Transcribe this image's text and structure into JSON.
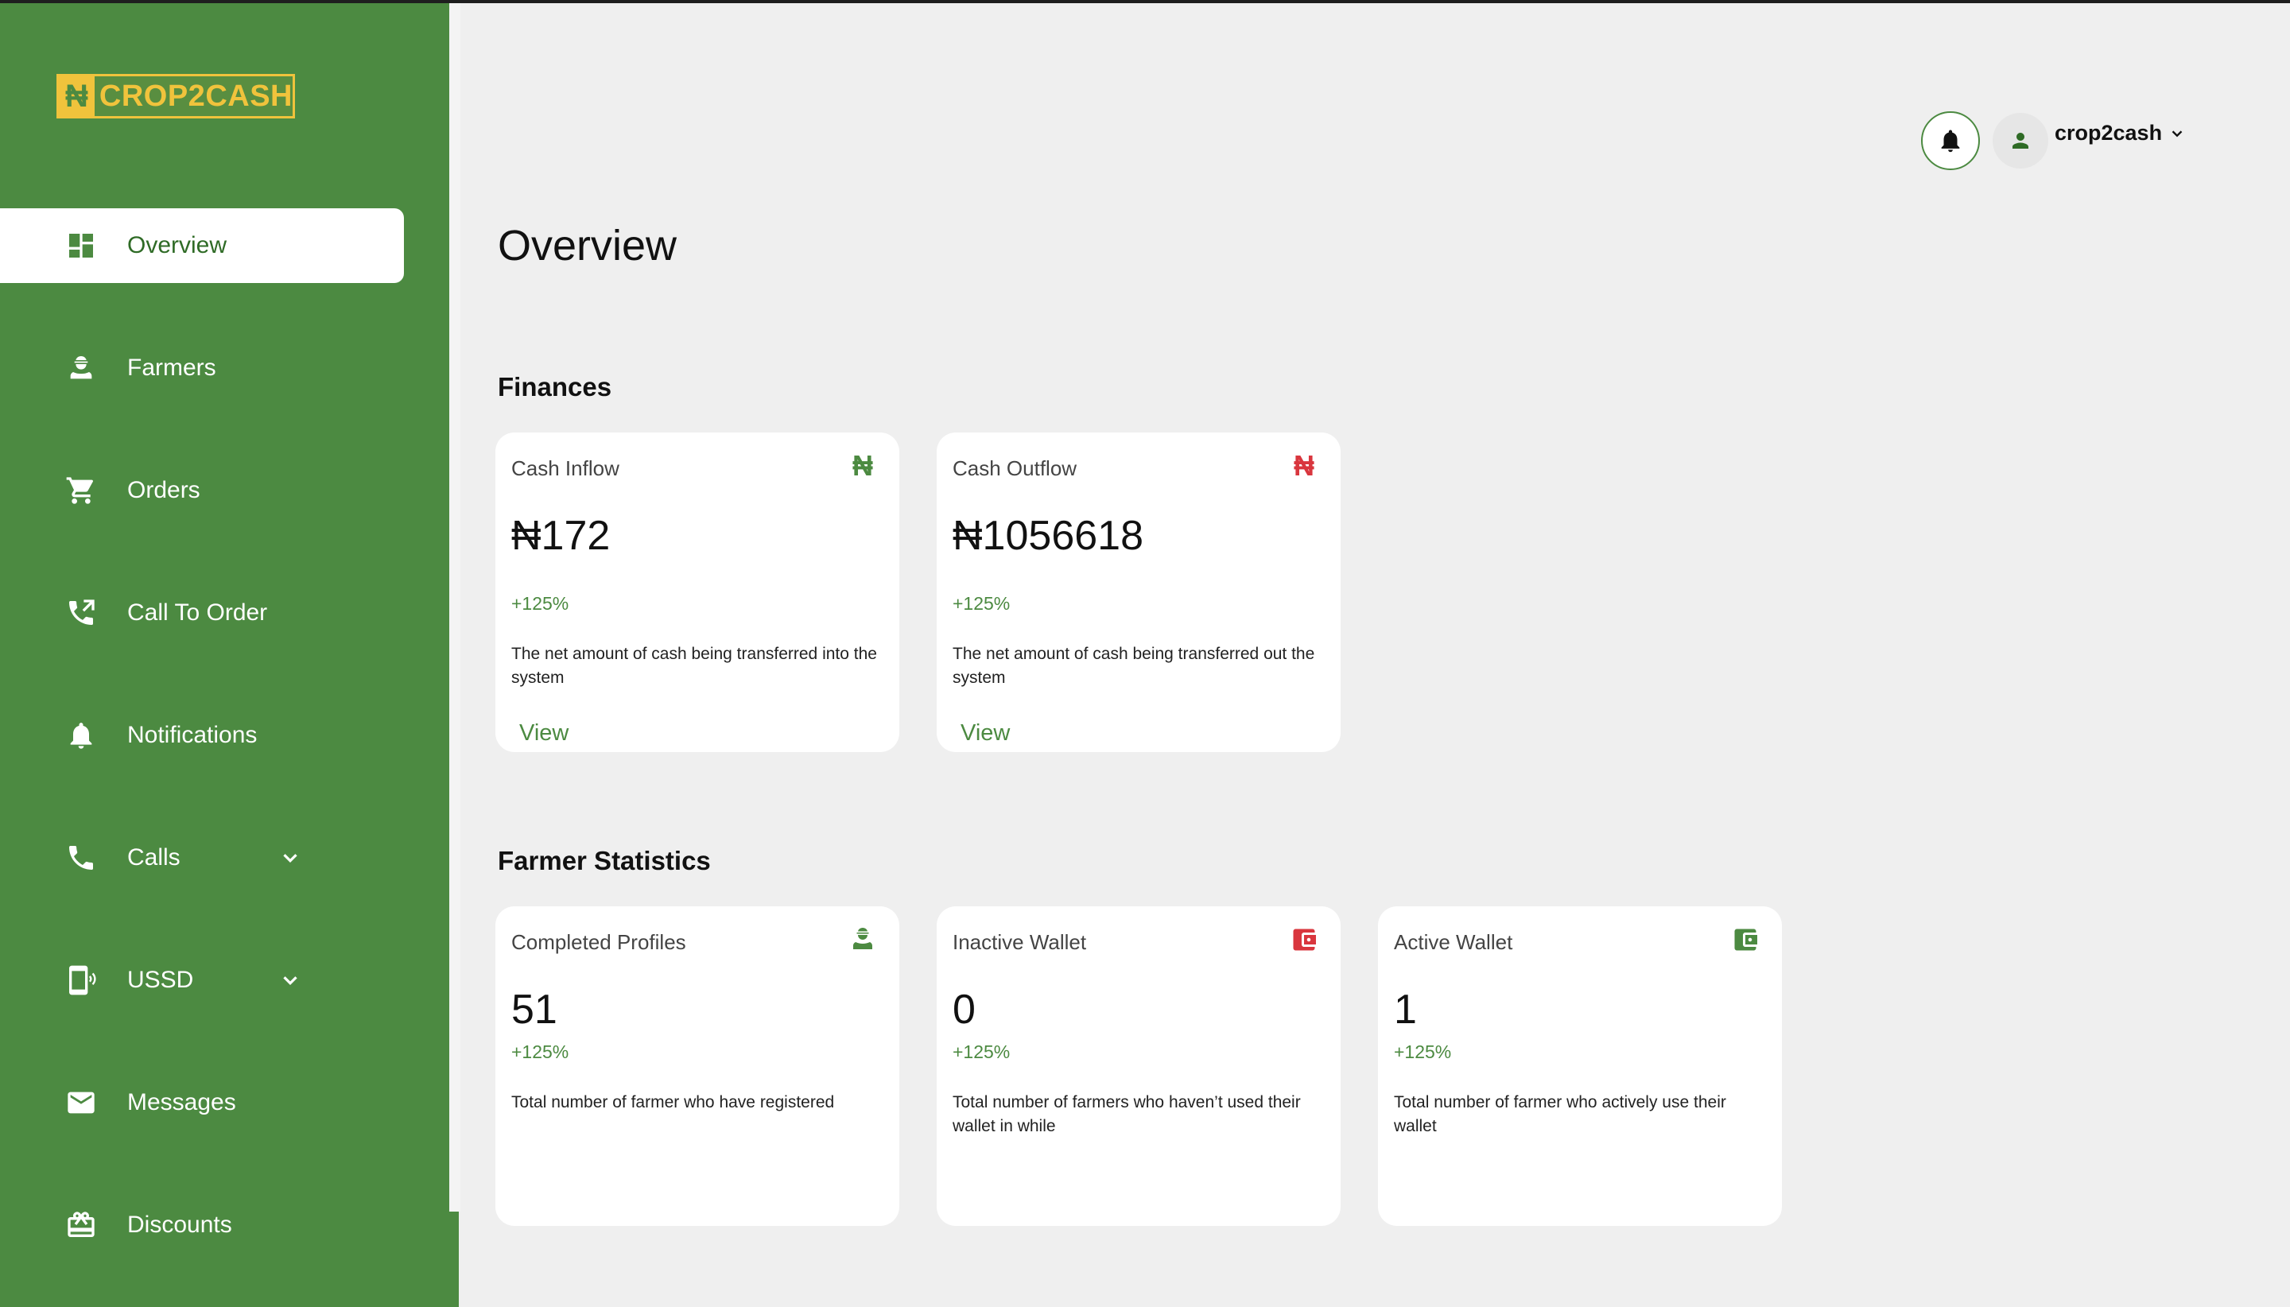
{
  "brand": {
    "logo_mark": "₦",
    "logo_text": "CROP2CASH",
    "color": "#4c8a41",
    "accent": "#f0c33c"
  },
  "sidebar": {
    "items": [
      {
        "label": "Overview",
        "icon": "dashboard-icon",
        "active": true
      },
      {
        "label": "Farmers",
        "icon": "farmer-icon"
      },
      {
        "label": "Orders",
        "icon": "cart-icon"
      },
      {
        "label": "Call To Order",
        "icon": "phone-forward-icon"
      },
      {
        "label": "Notifications",
        "icon": "bell-icon"
      },
      {
        "label": "Calls",
        "icon": "phone-icon",
        "expandable": true
      },
      {
        "label": "USSD",
        "icon": "mobile-icon",
        "expandable": true
      },
      {
        "label": "Messages",
        "icon": "mail-icon"
      },
      {
        "label": "Discounts",
        "icon": "gift-card-icon"
      }
    ]
  },
  "header": {
    "user": "crop2cash"
  },
  "page": {
    "title": "Overview"
  },
  "finances": {
    "title": "Finances",
    "cards": [
      {
        "title": "Cash Inflow",
        "icon": "naira-icon",
        "icon_color": "#4c8a41",
        "value": "₦172",
        "change": "+125%",
        "description": "The net amount of cash being transferred into the system",
        "action": "View"
      },
      {
        "title": "Cash Outflow",
        "icon": "naira-icon",
        "icon_color": "#d9363e",
        "value": "₦1056618",
        "change": "+125%",
        "description": "The net amount of cash being transferred out the system",
        "action": "View"
      }
    ]
  },
  "farmer_stats": {
    "title": "Farmer Statistics",
    "cards": [
      {
        "title": "Completed Profiles",
        "icon": "farmer-icon",
        "icon_color": "#4c8a41",
        "value": "51",
        "change": "+125%",
        "description": "Total number of farmer who have registered"
      },
      {
        "title": "Inactive Wallet",
        "icon": "wallet-icon",
        "icon_color": "#d9363e",
        "value": "0",
        "change": "+125%",
        "description": "Total number of farmers who haven’t used their wallet in while"
      },
      {
        "title": "Active Wallet",
        "icon": "wallet-icon",
        "icon_color": "#4c8a41",
        "value": "1",
        "change": "+125%",
        "description": "Total number of farmer who actively use their wallet"
      }
    ]
  }
}
